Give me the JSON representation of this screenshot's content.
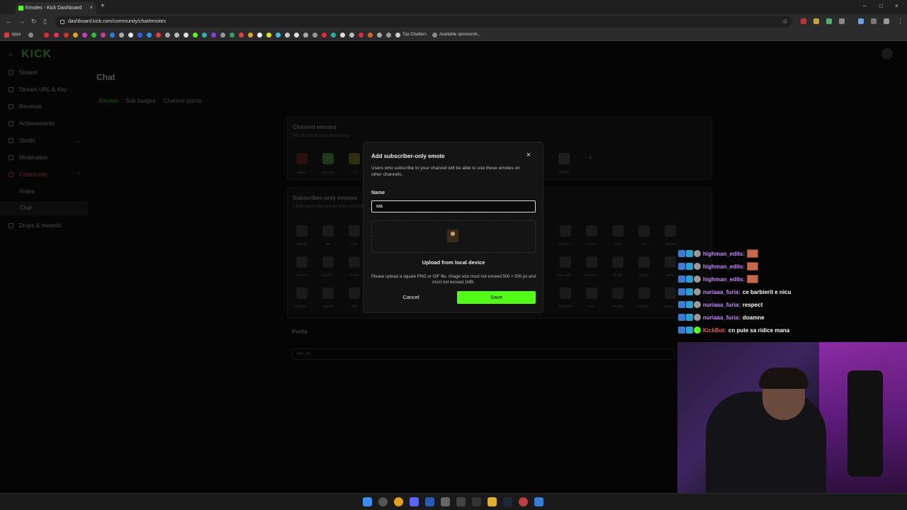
{
  "browser": {
    "tab_title": "Emotes - Kick Dashboard",
    "tab_close": "×",
    "new_tab": "+",
    "url": "dashboard.kick.com/community/chat/emotes",
    "bookmarks": {
      "apps_label": "Apps",
      "top_chatters": "Top Chatters",
      "available_sponsorships": "Available sponsorsh..."
    },
    "window_controls": {
      "minimize": "–",
      "maximize": "□",
      "close": "×"
    }
  },
  "logo": "KICK",
  "sidebar": {
    "items": [
      {
        "label": "Stream"
      },
      {
        "label": "Stream URL & Key"
      },
      {
        "label": "Revenue"
      },
      {
        "label": "Achievements"
      },
      {
        "label": "Studio"
      },
      {
        "label": "Moderation"
      },
      {
        "label": "Community"
      }
    ],
    "sub_items": [
      {
        "label": "Roles"
      },
      {
        "label": "Chat"
      }
    ],
    "after": {
      "label": "Drops & rewards"
    }
  },
  "page": {
    "title": "Chat",
    "tabs": [
      {
        "label": "Emotes"
      },
      {
        "label": "Sub badges"
      },
      {
        "label": "Channel points"
      }
    ],
    "channel_emotes": {
      "title": "Channel emotes",
      "subtitle": "40/100 emote slots remaining",
      "labels": [
        "aiskipt",
        "silencel",
        "CE",
        "frondflip",
        "nalgesal",
        "pelopla...",
        "pepenen...",
        "poiccano...",
        "pisiall",
        "W",
        "WHAT"
      ]
    },
    "subscriber_emotes": {
      "title": "Subscriber-only emotes",
      "subtitle": "13/60 subscriber emote slots remaining",
      "row1": [
        "aiskipt",
        "ayo",
        "blah"
      ],
      "row1_right": [
        "cronbs...",
        "cuba",
        "cuba",
        "cuz",
        "danbol"
      ],
      "row2": [
        "freaker",
        "laughe...",
        "limba"
      ],
      "row2_right": [
        "pinocado...",
        "plocami...",
        "pingfit",
        "putinz",
        "ratza"
      ],
      "row3": [
        "sleepyw...",
        "sparial",
        "sus"
      ],
      "row3_right": [
        "tecbride",
        "tarly",
        "vergillo",
        "wesker...",
        "wester..."
      ]
    },
    "prefix": {
      "label": "Prefix",
      "value": "kiel_34"
    }
  },
  "modal": {
    "title": "Add subscriber-only emote",
    "close": "×",
    "description": "Users who subscribe to your channel will be able to use these emotes on other channels.",
    "name_label": "Name",
    "name_value": "wa",
    "upload_label": "Upload from local device",
    "upload_help": "Please upload a square PNG or GIF file. Image size must not exceed 500 × 500 px and must not exceed 1MB.",
    "cancel_label": "Cancel",
    "save_label": "Save",
    "save_color": "#53fc18"
  },
  "overlay_chat": [
    {
      "user": "highman_edits:",
      "message": "",
      "user_color": "#c98bff",
      "emote": true
    },
    {
      "user": "highman_edits:",
      "message": "",
      "user_color": "#c98bff",
      "emote": true
    },
    {
      "user": "highman_edits:",
      "message": "",
      "user_color": "#c98bff",
      "emote": true
    },
    {
      "user": "nuriaaa_furia:",
      "message": "ce barbierit e nicu",
      "user_color": "#c98bff",
      "emote": false
    },
    {
      "user": "nuriaaa_furia:",
      "message": "respect",
      "user_color": "#c98bff",
      "emote": false
    },
    {
      "user": "nuriaaa_furia:",
      "message": "doamne",
      "user_color": "#c98bff",
      "emote": false
    },
    {
      "user": "KickBot:",
      "message": "cn pute sa ridice mana",
      "user_color": "#ff5555",
      "emote": false
    }
  ]
}
